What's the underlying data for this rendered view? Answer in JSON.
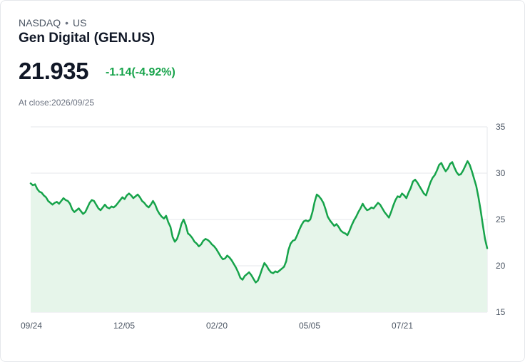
{
  "header": {
    "exchange": "NASDAQ",
    "separator": "•",
    "region": "US",
    "name": "Gen Digital (GEN.US)",
    "price": "21.935",
    "change": "-1.14(-4.92%)",
    "close_label": "At close:2026/09/25"
  },
  "colors": {
    "line": "#16a34a",
    "area": "#e6f5ea",
    "grid": "#e5e7eb",
    "change": "#16a34a"
  },
  "chart_data": {
    "type": "area",
    "ylim": [
      15,
      35
    ],
    "y_ticks": [
      35,
      30,
      25,
      20,
      15
    ],
    "x_tick_labels": [
      "09/24",
      "12/05",
      "02/20",
      "05/05",
      "07/21"
    ],
    "grid": true,
    "series": [
      {
        "values": [
          28.9,
          28.7,
          28.8,
          28.3,
          28.0,
          27.9,
          27.6,
          27.4,
          27.0,
          26.8,
          26.6,
          26.8,
          26.9,
          26.7,
          27.0,
          27.3,
          27.1,
          27.0,
          26.7,
          26.1,
          25.8,
          26.0,
          26.2,
          25.9,
          25.6,
          25.8,
          26.3,
          26.8,
          27.1,
          27.0,
          26.6,
          26.2,
          26.0,
          26.3,
          26.6,
          26.3,
          26.2,
          26.4,
          26.3,
          26.5,
          26.8,
          27.1,
          27.4,
          27.2,
          27.6,
          27.8,
          27.6,
          27.3,
          27.5,
          27.7,
          27.4,
          27.0,
          26.8,
          26.5,
          26.3,
          26.6,
          27.0,
          26.6,
          26.0,
          25.6,
          25.3,
          25.1,
          25.4,
          24.7,
          24.2,
          23.1,
          22.6,
          22.9,
          23.6,
          24.5,
          25.0,
          24.4,
          23.5,
          23.3,
          23.0,
          22.6,
          22.4,
          22.1,
          22.3,
          22.7,
          22.9,
          22.8,
          22.6,
          22.3,
          22.1,
          21.8,
          21.4,
          21.0,
          20.7,
          20.8,
          21.1,
          20.9,
          20.6,
          20.2,
          19.8,
          19.3,
          18.7,
          18.5,
          18.9,
          19.1,
          19.3,
          19.0,
          18.6,
          18.2,
          18.4,
          19.0,
          19.7,
          20.3,
          20.0,
          19.6,
          19.3,
          19.2,
          19.4,
          19.3,
          19.5,
          19.7,
          19.9,
          20.5,
          21.7,
          22.4,
          22.7,
          22.8,
          23.3,
          23.9,
          24.4,
          24.8,
          24.9,
          24.8,
          25.0,
          25.8,
          26.9,
          27.7,
          27.5,
          27.2,
          26.8,
          26.1,
          25.3,
          24.9,
          24.6,
          24.3,
          24.5,
          24.2,
          23.8,
          23.6,
          23.5,
          23.3,
          23.8,
          24.4,
          24.9,
          25.3,
          25.8,
          26.2,
          26.7,
          26.3,
          26.0,
          26.1,
          26.3,
          26.2,
          26.5,
          26.8,
          26.6,
          26.2,
          25.8,
          25.5,
          25.2,
          25.8,
          26.5,
          27.1,
          27.5,
          27.4,
          27.8,
          27.6,
          27.3,
          27.9,
          28.4,
          29.1,
          29.3,
          29.0,
          28.6,
          28.2,
          27.8,
          27.6,
          28.3,
          29.0,
          29.5,
          29.8,
          30.3,
          30.9,
          31.1,
          30.6,
          30.2,
          30.5,
          31.0,
          31.2,
          30.6,
          30.1,
          29.8,
          29.9,
          30.3,
          30.8,
          31.3,
          30.9,
          30.2,
          29.4,
          28.6,
          27.4,
          26.0,
          24.4,
          22.9,
          21.9
        ]
      }
    ]
  }
}
